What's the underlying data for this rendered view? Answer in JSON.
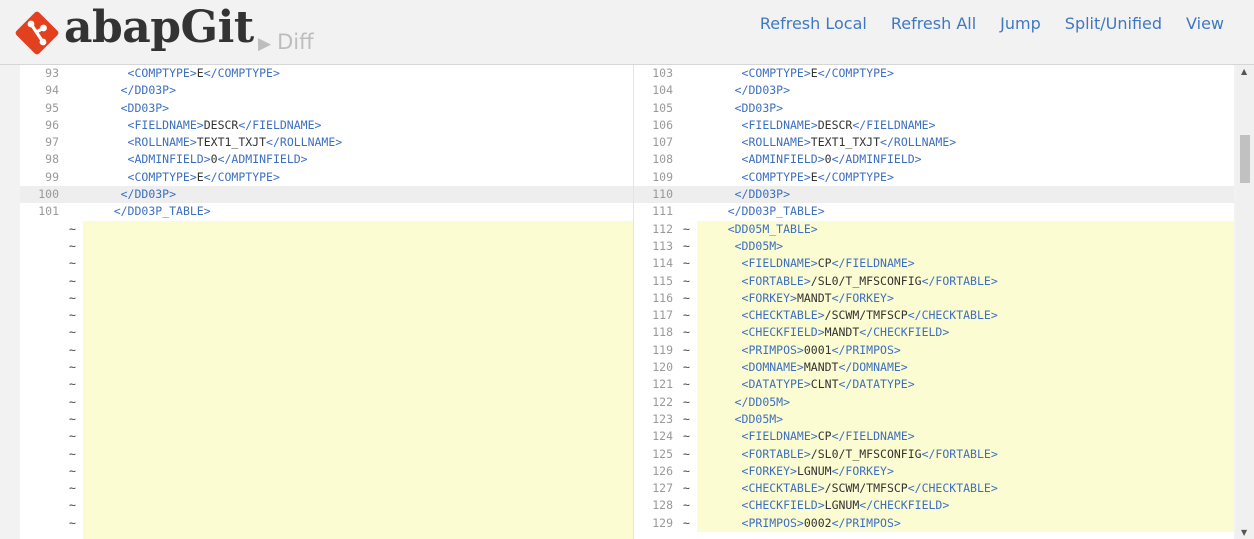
{
  "brand": {
    "name": "abapGit",
    "page_arrow": "▶",
    "page": "Diff",
    "logo_color": "#e2401f"
  },
  "nav": [
    {
      "label": "Refresh Local"
    },
    {
      "label": "Refresh All"
    },
    {
      "label": "Jump"
    },
    {
      "label": "Split/Unified"
    },
    {
      "label": "View"
    }
  ],
  "colors": {
    "link": "#4078c0",
    "tag": "#3d6fc1",
    "added_bg": "#fcfcd2"
  },
  "diff": {
    "left": [
      {
        "num": "93",
        "mark": "",
        "code": "      <COMPTYPE>E</COMPTYPE>"
      },
      {
        "num": "94",
        "mark": "",
        "code": "     </DD03P>"
      },
      {
        "num": "95",
        "mark": "",
        "code": "     <DD03P>"
      },
      {
        "num": "96",
        "mark": "",
        "code": "      <FIELDNAME>DESCR</FIELDNAME>"
      },
      {
        "num": "97",
        "mark": "",
        "code": "      <ROLLNAME>TEXT1_TXJT</ROLLNAME>"
      },
      {
        "num": "98",
        "mark": "",
        "code": "      <ADMINFIELD>0</ADMINFIELD>"
      },
      {
        "num": "99",
        "mark": "",
        "code": "      <COMPTYPE>E</COMPTYPE>"
      },
      {
        "num": "100",
        "mark": "",
        "code": "     </DD03P>",
        "state": "cur"
      },
      {
        "num": "101",
        "mark": "",
        "code": "    </DD03P_TABLE>"
      },
      {
        "num": "",
        "mark": "~",
        "code": "",
        "state": "empty"
      },
      {
        "num": "",
        "mark": "~",
        "code": "",
        "state": "empty"
      },
      {
        "num": "",
        "mark": "~",
        "code": "",
        "state": "empty"
      },
      {
        "num": "",
        "mark": "~",
        "code": "",
        "state": "empty"
      },
      {
        "num": "",
        "mark": "~",
        "code": "",
        "state": "empty"
      },
      {
        "num": "",
        "mark": "~",
        "code": "",
        "state": "empty"
      },
      {
        "num": "",
        "mark": "~",
        "code": "",
        "state": "empty"
      },
      {
        "num": "",
        "mark": "~",
        "code": "",
        "state": "empty"
      },
      {
        "num": "",
        "mark": "~",
        "code": "",
        "state": "empty"
      },
      {
        "num": "",
        "mark": "~",
        "code": "",
        "state": "empty"
      },
      {
        "num": "",
        "mark": "~",
        "code": "",
        "state": "empty"
      },
      {
        "num": "",
        "mark": "~",
        "code": "",
        "state": "empty"
      },
      {
        "num": "",
        "mark": "~",
        "code": "",
        "state": "empty"
      },
      {
        "num": "",
        "mark": "~",
        "code": "",
        "state": "empty"
      },
      {
        "num": "",
        "mark": "~",
        "code": "",
        "state": "empty"
      },
      {
        "num": "",
        "mark": "~",
        "code": "",
        "state": "empty"
      },
      {
        "num": "",
        "mark": "~",
        "code": "",
        "state": "empty"
      },
      {
        "num": "",
        "mark": "~",
        "code": "",
        "state": "empty"
      },
      {
        "num": "",
        "mark": "~",
        "code": "",
        "state": "empty"
      }
    ],
    "right": [
      {
        "num": "103",
        "mark": "",
        "code": "      <COMPTYPE>E</COMPTYPE>"
      },
      {
        "num": "104",
        "mark": "",
        "code": "     </DD03P>"
      },
      {
        "num": "105",
        "mark": "",
        "code": "     <DD03P>"
      },
      {
        "num": "106",
        "mark": "",
        "code": "      <FIELDNAME>DESCR</FIELDNAME>"
      },
      {
        "num": "107",
        "mark": "",
        "code": "      <ROLLNAME>TEXT1_TXJT</ROLLNAME>"
      },
      {
        "num": "108",
        "mark": "",
        "code": "      <ADMINFIELD>0</ADMINFIELD>"
      },
      {
        "num": "109",
        "mark": "",
        "code": "      <COMPTYPE>E</COMPTYPE>"
      },
      {
        "num": "110",
        "mark": "",
        "code": "     </DD03P>",
        "state": "cur"
      },
      {
        "num": "111",
        "mark": "",
        "code": "    </DD03P_TABLE>"
      },
      {
        "num": "112",
        "mark": "~",
        "code": "    <DD05M_TABLE>",
        "state": "added"
      },
      {
        "num": "113",
        "mark": "~",
        "code": "     <DD05M>",
        "state": "added"
      },
      {
        "num": "114",
        "mark": "~",
        "code": "      <FIELDNAME>CP</FIELDNAME>",
        "state": "added"
      },
      {
        "num": "115",
        "mark": "~",
        "code": "      <FORTABLE>/SL0/T_MFSCONFIG</FORTABLE>",
        "state": "added"
      },
      {
        "num": "116",
        "mark": "~",
        "code": "      <FORKEY>MANDT</FORKEY>",
        "state": "added"
      },
      {
        "num": "117",
        "mark": "~",
        "code": "      <CHECKTABLE>/SCWM/TMFSCP</CHECKTABLE>",
        "state": "added"
      },
      {
        "num": "118",
        "mark": "~",
        "code": "      <CHECKFIELD>MANDT</CHECKFIELD>",
        "state": "added"
      },
      {
        "num": "119",
        "mark": "~",
        "code": "      <PRIMPOS>0001</PRIMPOS>",
        "state": "added"
      },
      {
        "num": "120",
        "mark": "~",
        "code": "      <DOMNAME>MANDT</DOMNAME>",
        "state": "added"
      },
      {
        "num": "121",
        "mark": "~",
        "code": "      <DATATYPE>CLNT</DATATYPE>",
        "state": "added"
      },
      {
        "num": "122",
        "mark": "~",
        "code": "     </DD05M>",
        "state": "added"
      },
      {
        "num": "123",
        "mark": "~",
        "code": "     <DD05M>",
        "state": "added"
      },
      {
        "num": "124",
        "mark": "~",
        "code": "      <FIELDNAME>CP</FIELDNAME>",
        "state": "added"
      },
      {
        "num": "125",
        "mark": "~",
        "code": "      <FORTABLE>/SL0/T_MFSCONFIG</FORTABLE>",
        "state": "added"
      },
      {
        "num": "126",
        "mark": "~",
        "code": "      <FORKEY>LGNUM</FORKEY>",
        "state": "added"
      },
      {
        "num": "127",
        "mark": "~",
        "code": "      <CHECKTABLE>/SCWM/TMFSCP</CHECKTABLE>",
        "state": "added"
      },
      {
        "num": "128",
        "mark": "~",
        "code": "      <CHECKFIELD>LGNUM</CHECKFIELD>",
        "state": "added"
      },
      {
        "num": "129",
        "mark": "~",
        "code": "      <PRIMPOS>0002</PRIMPOS>",
        "state": "added"
      }
    ]
  }
}
